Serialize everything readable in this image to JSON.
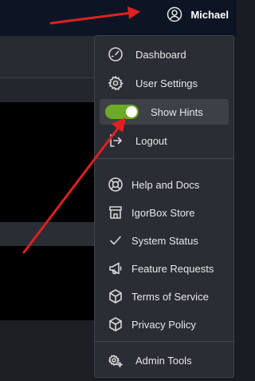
{
  "header": {
    "username": "Michael"
  },
  "menu": {
    "items": [
      {
        "label": "Dashboard",
        "icon": "gauge-icon"
      },
      {
        "label": "User Settings",
        "icon": "gear-icon"
      },
      {
        "label": "Show Hints",
        "icon": "toggle",
        "state": "on"
      },
      {
        "label": "Logout",
        "icon": "logout-icon"
      },
      {
        "label": "Help and Docs",
        "icon": "lifebuoy-icon"
      },
      {
        "label": "IgorBox Store",
        "icon": "store-icon"
      },
      {
        "label": "System Status",
        "icon": "check-icon"
      },
      {
        "label": "Feature Requests",
        "icon": "megaphone-icon"
      },
      {
        "label": "Terms of Service",
        "icon": "cube-icon"
      },
      {
        "label": "Privacy Policy",
        "icon": "cube-icon"
      },
      {
        "label": "Admin Tools",
        "icon": "gears-icon"
      }
    ]
  },
  "colors": {
    "topbar": "#0d1524",
    "menu_bg": "#2a2d34",
    "toggle_on": "#6cab26",
    "annotation_arrow": "#e02020"
  }
}
